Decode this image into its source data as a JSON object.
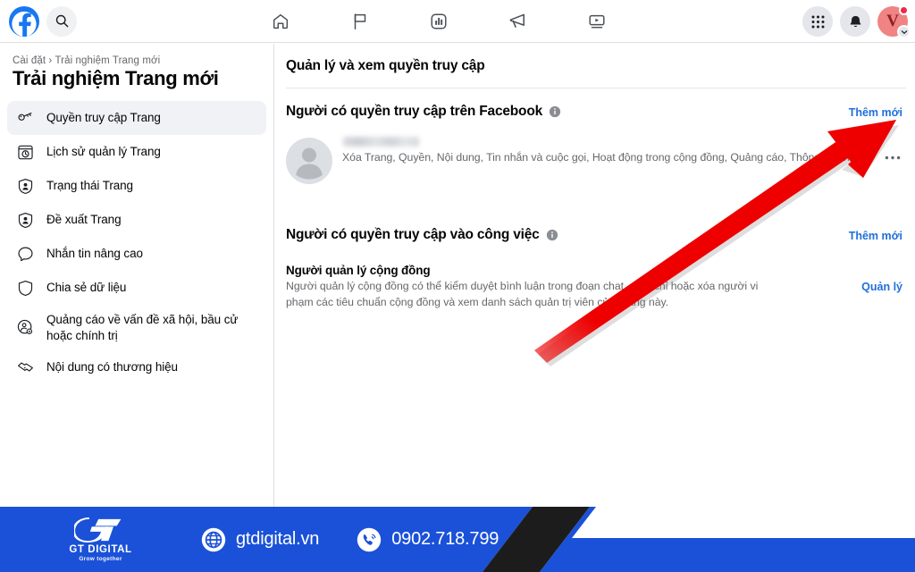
{
  "topbar": {
    "logo_icon": "facebook-logo-icon",
    "search_icon": "search-icon",
    "nav_icons": [
      {
        "name": "home-icon",
        "label": "Trang chủ"
      },
      {
        "name": "flag-icon",
        "label": "Trang"
      },
      {
        "name": "insights-chart-icon",
        "label": "Thông tin chi tiết"
      },
      {
        "name": "megaphone-ad-icon",
        "label": "Quảng cáo"
      },
      {
        "name": "video-icon",
        "label": "Video"
      }
    ],
    "apps_grid_icon": "apps-grid-icon",
    "notifications_icon": "bell-icon",
    "avatar_letter": "V",
    "avatar_has_badge": true,
    "avatar_chevron_icon": "chevron-down-icon"
  },
  "sidebar": {
    "breadcrumb": "Cài đặt › Trải nghiệm Trang mới",
    "title": "Trải nghiệm Trang mới",
    "items": [
      {
        "label": "Quyền truy cập Trang",
        "icon": "key-icon",
        "active": true
      },
      {
        "label": "Lịch sử quản lý Trang",
        "icon": "history-window-icon",
        "active": false
      },
      {
        "label": "Trạng thái Trang",
        "icon": "shield-person-icon",
        "active": false
      },
      {
        "label": "Đề xuất Trang",
        "icon": "shield-person-icon",
        "active": false
      },
      {
        "label": "Nhắn tin nâng cao",
        "icon": "speech-bubble-icon",
        "active": false
      },
      {
        "label": "Chia sẻ dữ liệu",
        "icon": "shield-icon",
        "active": false
      },
      {
        "label": "Quảng cáo về vấn đề xã hội, bầu cử hoặc chính trị",
        "icon": "person-gear-icon",
        "active": false
      },
      {
        "label": "Nội dung có thương hiệu",
        "icon": "handshake-icon",
        "active": false
      }
    ]
  },
  "main": {
    "title": "Quản lý và xem quyền truy cập",
    "facebook_access": {
      "heading": "Người có quyền truy cập trên Facebook",
      "info_icon": "info-circle-icon",
      "add_link": "Thêm mới",
      "person": {
        "name_blurred": true,
        "avatar_icon": "person-avatar-icon",
        "permissions": "Xóa Trang, Quyền, Nội dung, Tin nhắn và cuộc gọi, Hoạt động trong cộng đồng, Quảng cáo, Thông tin chi tiết",
        "more_icon": "ellipsis-horizontal-icon"
      }
    },
    "work_access": {
      "heading": "Người có quyền truy cập vào công việc",
      "info_icon": "info-circle-icon",
      "add_link": "Thêm mới",
      "community_manager": {
        "title": "Người quản lý cộng đồng",
        "description": "Người quản lý cộng đồng có thể kiểm duyệt bình luận trong đoạn chat, đình chỉ hoặc xóa người vi phạm các tiêu chuẩn cộng đồng và xem danh sách quản trị viên của Trang này.",
        "manage_link": "Quản lý"
      }
    }
  },
  "annotation": {
    "arrow_color": "#ee0000",
    "arrow_target": "Thêm mới"
  },
  "banner": {
    "brand_name": "GT DIGITAL",
    "brand_tagline": "Grow together",
    "brand_mark_icon": "gt-monogram-icon",
    "website_icon": "globe-icon",
    "website": "gtdigital.vn",
    "phone_icon": "phone-call-icon",
    "phone": "0902.718.799",
    "colors": {
      "blue": "#1a51d8",
      "black": "#1c1c1c"
    }
  }
}
